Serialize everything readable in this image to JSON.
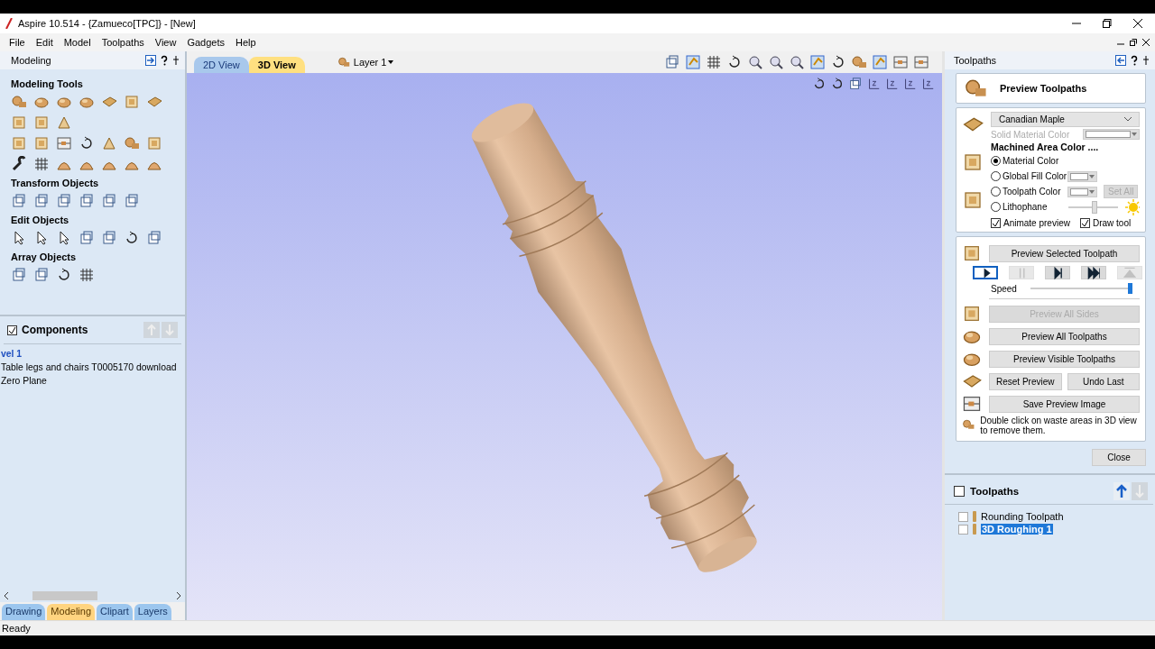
{
  "window": {
    "title": "Aspire 10.514 - {Zamueco[TPC]} - [New]"
  },
  "menu": [
    "File",
    "Edit",
    "Model",
    "Toolpaths",
    "View",
    "Gadgets",
    "Help"
  ],
  "left_panel": {
    "title": "Modeling",
    "groups": [
      {
        "title": "Modeling Tools"
      },
      {
        "title": "Transform Objects"
      },
      {
        "title": "Edit Objects"
      },
      {
        "title": "Array Objects"
      }
    ],
    "components": {
      "title": "Components",
      "checked": true,
      "items": [
        {
          "text": "vel 1",
          "kind": "level"
        },
        {
          "text": "Table legs and chairs T0005170 download",
          "kind": "item"
        },
        {
          "text": "Zero Plane",
          "kind": "item"
        }
      ]
    },
    "tabs": [
      {
        "label": "Drawing",
        "selected": false
      },
      {
        "label": "Modeling",
        "selected": true
      },
      {
        "label": "Clipart",
        "selected": false
      },
      {
        "label": "Layers",
        "selected": false
      }
    ]
  },
  "view_tabs": [
    {
      "label": "2D View",
      "selected": false
    },
    {
      "label": "3D View",
      "selected": true
    }
  ],
  "layer": "Layer 1",
  "right_panel": {
    "title": "Toolpaths",
    "heading": "Preview Toolpaths",
    "material": "Canadian Maple",
    "solid_color_label": "Solid Material Color",
    "machined_heading": "Machined Area Color ....",
    "radios": [
      {
        "label": "Material Color",
        "selected": true,
        "kind": "plain"
      },
      {
        "label": "Global Fill Color",
        "selected": false,
        "kind": "swatch"
      },
      {
        "label": "Toolpath Color",
        "selected": false,
        "kind": "swatch_setall"
      },
      {
        "label": "Lithophane",
        "selected": false,
        "kind": "slider"
      }
    ],
    "set_all": "Set All",
    "lithophane": {
      "level": 0.5
    },
    "animate_preview": {
      "label": "Animate preview",
      "checked": true
    },
    "draw_tool": {
      "label": "Draw tool",
      "checked": true
    },
    "preview_selected": "Preview Selected Toolpath",
    "playback": [
      {
        "kind": "play",
        "selected": true,
        "disabled": false
      },
      {
        "kind": "pause",
        "selected": false,
        "disabled": true
      },
      {
        "kind": "step",
        "selected": false,
        "disabled": false
      },
      {
        "kind": "end",
        "selected": false,
        "disabled": false
      },
      {
        "kind": "top",
        "selected": false,
        "disabled": true
      }
    ],
    "speed": {
      "label": "Speed",
      "level": 1
    },
    "actions": [
      {
        "label": "Preview All Sides",
        "disabled": true,
        "kind": "wide"
      },
      {
        "label": "Preview All Toolpaths",
        "disabled": false,
        "kind": "wide"
      },
      {
        "label": "Preview Visible Toolpaths",
        "disabled": false,
        "kind": "wide"
      },
      {
        "label": "Reset Preview",
        "disabled": false,
        "kind": "pair"
      },
      {
        "label": "Undo Last",
        "disabled": false,
        "kind": "pair"
      },
      {
        "label": "Save Preview Image",
        "disabled": false,
        "kind": "wide"
      }
    ],
    "hint": "Double click on waste areas in 3D view to remove them.",
    "close": "Close",
    "toolpaths": {
      "title": "Toolpaths",
      "checked": false,
      "items": [
        {
          "name": "Rounding Toolpath",
          "checked": false,
          "selected": false
        },
        {
          "name": "3D Roughing 1",
          "checked": false,
          "selected": true
        }
      ]
    }
  },
  "status_bar": "Ready"
}
